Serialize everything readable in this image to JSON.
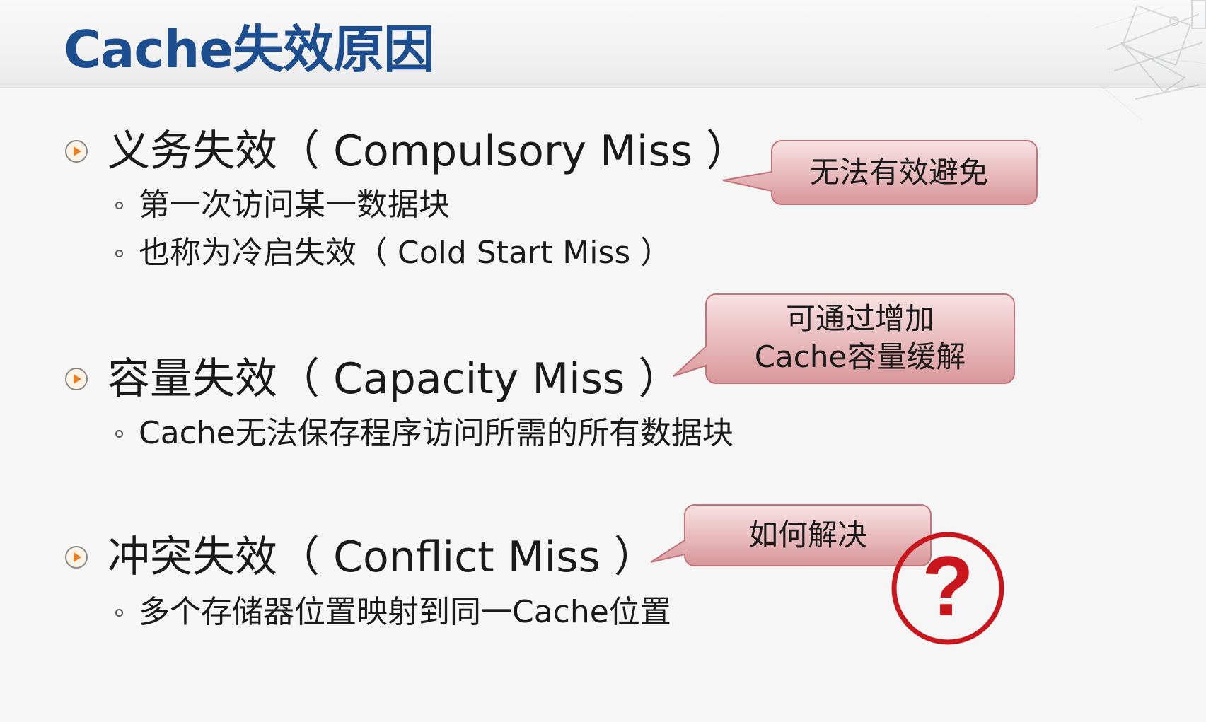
{
  "slide": {
    "title": "Cache失效原因"
  },
  "sections": [
    {
      "heading": "义务失效（ Compulsory Miss ）",
      "items": [
        "第一次访问某一数据块",
        "也称为冷启失效（ Cold Start Miss ）"
      ],
      "callout_lines": [
        "无法有效避免"
      ]
    },
    {
      "heading": "容量失效（ Capacity Miss ）",
      "items": [
        "Cache无法保存程序访问所需的所有数据块"
      ],
      "callout_lines": [
        "可通过增加",
        "Cache容量缓解"
      ]
    },
    {
      "heading": "冲突失效（ Conflict Miss ）",
      "items": [
        "多个存储器位置映射到同一Cache位置"
      ],
      "callout_lines": [
        "如何解决"
      ]
    }
  ],
  "question_mark": "?",
  "icons": {
    "bullet": "play-circle-icon",
    "sub_bullet": "hollow-circle-icon",
    "question": "question-circle-icon",
    "decoration": "drafting-tools-decoration"
  },
  "colors": {
    "title": "#1d4e8f",
    "callout_fill_top": "#f6dadb",
    "callout_fill_bottom": "#d99a9c",
    "callout_stroke": "#c47478",
    "bullet_orange": "#e87d22",
    "question_red": "#c9161c"
  }
}
